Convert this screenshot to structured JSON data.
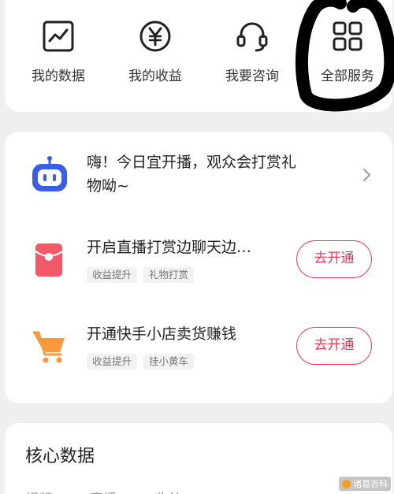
{
  "services": [
    {
      "label": "我的数据",
      "icon": "chart-icon"
    },
    {
      "label": "我的收益",
      "icon": "yuan-icon"
    },
    {
      "label": "我要咨询",
      "icon": "headset-icon"
    },
    {
      "label": "全部服务",
      "icon": "grid-icon"
    }
  ],
  "announcement": {
    "text": "嗨！今日宜开播，观众会打赏礼物呦~",
    "line1": "嗨！今日宜开播，观众会打赏礼",
    "line2": "物呦~"
  },
  "promos": [
    {
      "title": "开启直播打赏边聊天边…",
      "tags": [
        "收益提升",
        "礼物打赏"
      ],
      "button": "去开通",
      "icon": "red-envelope-icon"
    },
    {
      "title": "开通快手小店卖货赚钱",
      "tags": [
        "收益提升",
        "挂小黄车"
      ],
      "button": "去开通",
      "icon": "shopping-cart-icon"
    }
  ],
  "core": {
    "title": "核心数据",
    "tabs": [
      "视频",
      "直播",
      "收益"
    ]
  },
  "watermark": "诸葛百科",
  "colors": {
    "accent": "#e7385a",
    "robot_blue": "#3a5ee8",
    "envelope_red": "#f25a6a",
    "cart_orange": "#f79a3e"
  }
}
